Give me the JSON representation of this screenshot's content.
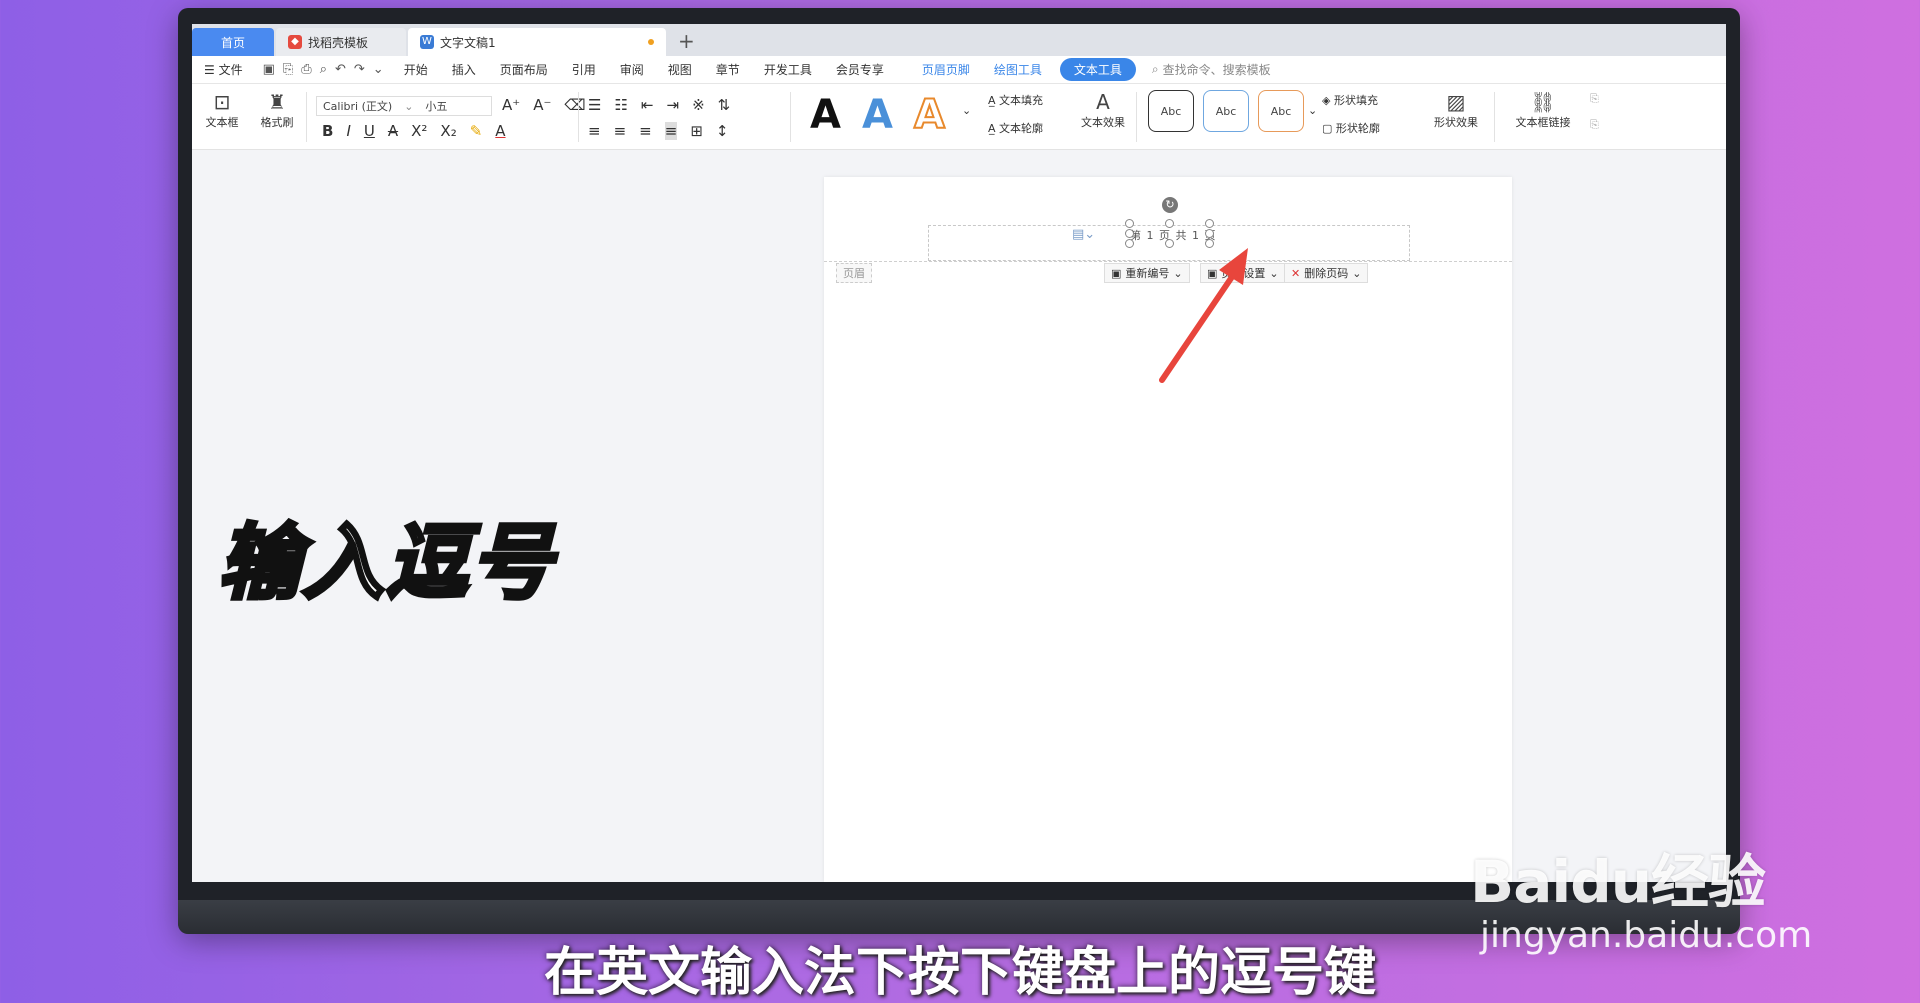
{
  "tabs": [
    {
      "label": "首页"
    },
    {
      "label": "找稻壳模板"
    },
    {
      "label": "文字文稿1"
    }
  ],
  "tab_add": "+",
  "menu": {
    "file": "文件",
    "items": [
      "开始",
      "插入",
      "页面布局",
      "引用",
      "审阅",
      "视图",
      "章节",
      "开发工具",
      "会员专享"
    ],
    "context_items": [
      "页眉页脚",
      "绘图工具"
    ],
    "active": "文本工具",
    "search": "查找命令、搜索模板"
  },
  "ribbon": {
    "textbox": "文本框",
    "format_painter": "格式刷",
    "font_name": "Calibri (正文)",
    "font_size": "小五",
    "text_fill": "文本填充",
    "text_outline": "文本轮廓",
    "text_effect": "文本效果",
    "shape_fill": "形状填充",
    "shape_outline": "形状轮廓",
    "shape_effect": "形状效果",
    "textbox_link": "文本框链接",
    "style_abc": [
      "Abc",
      "Abc",
      "Abc"
    ],
    "big_letters": [
      "A",
      "A",
      "A"
    ]
  },
  "document": {
    "page_number_text": "第 1 页 共 1 页",
    "header_label": "页眉",
    "renumber": "重新编号",
    "page_setting": "页码设置",
    "delete_page_number": "删除页码"
  },
  "overlay": {
    "callout": "输入逗号",
    "subtitle": "在英文输入法下按下键盘上的逗号键",
    "watermark_brand": "Baidu经验",
    "watermark_url": "jingyan.baidu.com"
  },
  "colors": {
    "accent": "#3a86e8",
    "arrow": "#e8453c",
    "background": "#b36ce2"
  }
}
